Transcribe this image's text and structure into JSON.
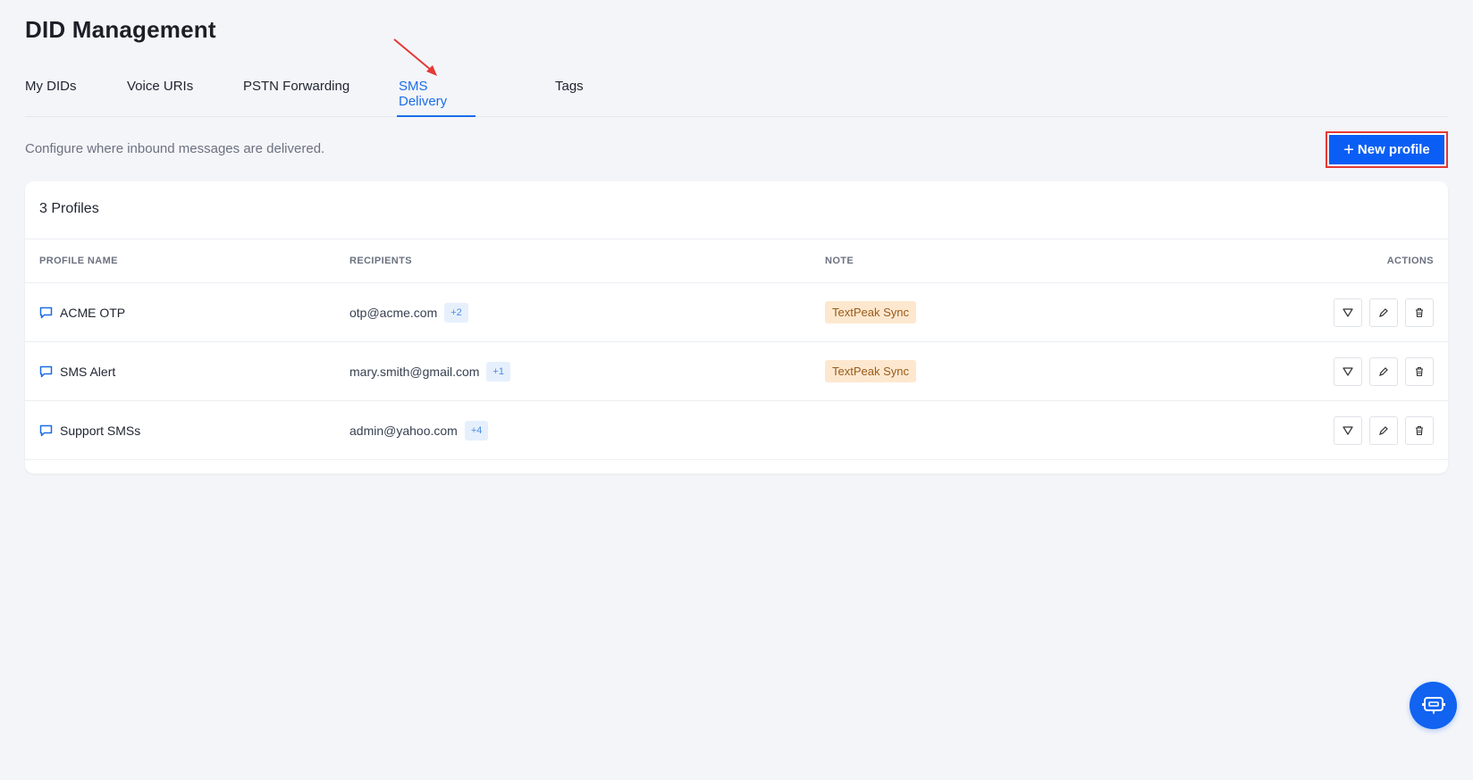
{
  "page": {
    "title": "DID Management"
  },
  "tabs": [
    {
      "label": "My DIDs"
    },
    {
      "label": "Voice URIs"
    },
    {
      "label": "PSTN Forwarding"
    },
    {
      "label": "SMS Delivery",
      "active": true
    },
    {
      "label": "Tags"
    }
  ],
  "subtitle": "Configure where inbound messages are delivered.",
  "new_profile_button": {
    "label": "New profile",
    "icon": "plus-icon"
  },
  "profiles_card": {
    "title": "3 Profiles",
    "headers": {
      "profile_name": "PROFILE NAME",
      "recipients": "RECIPIENTS",
      "note": "NOTE",
      "actions": "ACTIONS"
    },
    "rows": [
      {
        "name": "ACME OTP",
        "recipient": "otp@acme.com",
        "extra": "+2",
        "note": "TextPeak Sync"
      },
      {
        "name": "SMS Alert",
        "recipient": "mary.smith@gmail.com",
        "extra": "+1",
        "note": "TextPeak Sync"
      },
      {
        "name": "Support SMSs",
        "recipient": "admin@yahoo.com",
        "extra": "+4",
        "note": ""
      }
    ]
  },
  "colors": {
    "accent": "#1a6de8",
    "button": "#0b5ef5",
    "note_bg": "#fde8cf",
    "highlight": "#e53935"
  }
}
